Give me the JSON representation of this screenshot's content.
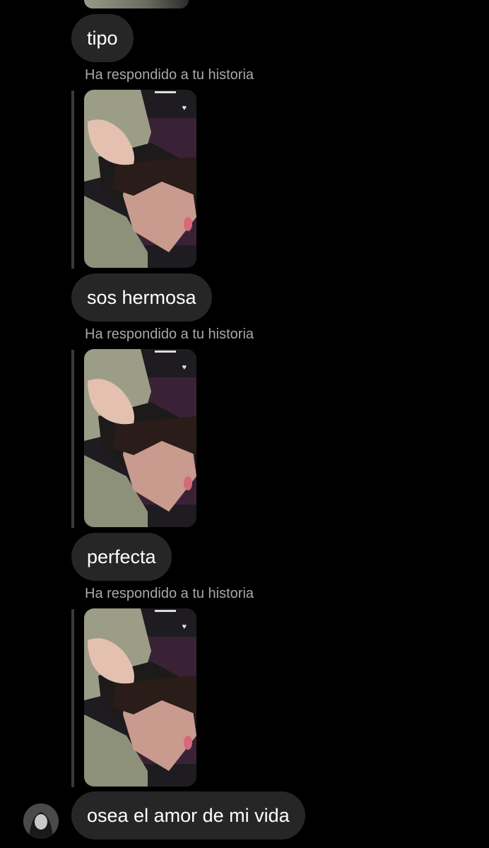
{
  "messages": [
    {
      "type": "text",
      "text": "tipo"
    },
    {
      "type": "story_reply",
      "label": "Ha respondido a tu historia"
    },
    {
      "type": "text",
      "text": "sos hermosa"
    },
    {
      "type": "story_reply",
      "label": "Ha respondido a tu historia"
    },
    {
      "type": "text",
      "text": "perfecta"
    },
    {
      "type": "story_reply",
      "label": "Ha respondido a tu historia"
    },
    {
      "type": "text",
      "text": "osea el amor de mi vida",
      "with_avatar": true
    }
  ],
  "colors": {
    "background": "#000000",
    "bubble": "#262626",
    "bubble_text": "#ffffff",
    "label_text": "#a8a8a8",
    "reply_bar": "#3a3a3a"
  },
  "icons": {
    "story_like": "heart-icon",
    "sender": "avatar"
  }
}
